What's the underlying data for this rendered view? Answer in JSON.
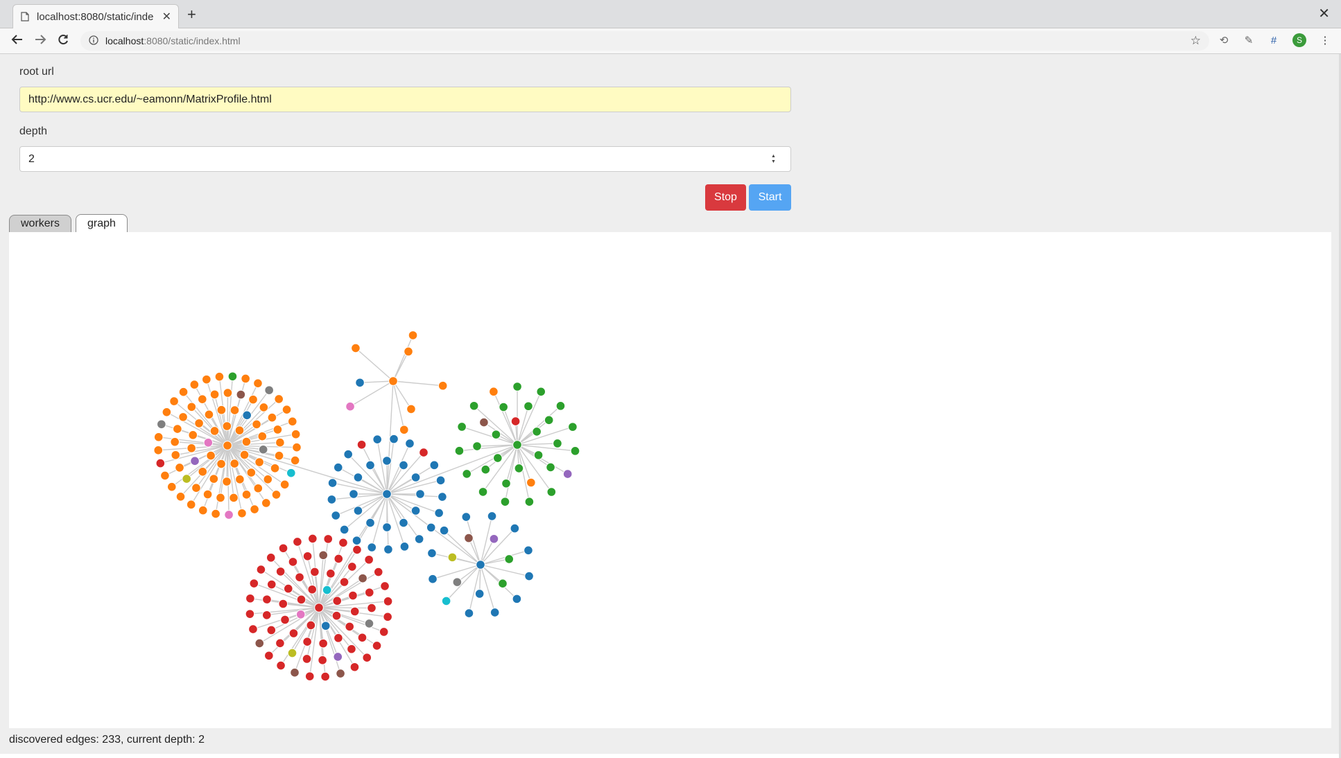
{
  "browser": {
    "tab_title": "localhost:8080/static/inde",
    "address_host": "localhost",
    "address_path": ":8080/static/index.html",
    "avatar_letter": "S"
  },
  "form": {
    "root_label": "root url",
    "root_value": "http://www.cs.ucr.edu/~eamonn/MatrixProfile.html",
    "depth_label": "depth",
    "depth_value": "2",
    "stop_label": "Stop",
    "start_label": "Start"
  },
  "tabs": [
    {
      "label": "workers",
      "active": false
    },
    {
      "label": "graph",
      "active": true
    }
  ],
  "status": "discovered edges: 233, current depth: 2",
  "colors": {
    "stop": "#d9393e",
    "start": "#55a5f3",
    "url_field": "#fffbc2",
    "edge": "#cccccc",
    "node_palette": {
      "orange": "#ff7f0e",
      "blue": "#1f77b4",
      "green": "#2ca02c",
      "red": "#d62728",
      "purple": "#9467bd",
      "brown": "#8c564b",
      "pink": "#e377c2",
      "gray": "#7f7f7f",
      "olive": "#bcbd22",
      "cyan": "#17becf"
    }
  },
  "graph": {
    "hubs": [
      {
        "id": "center",
        "color": "blue",
        "leaves": [
          "blue",
          "blue",
          "blue",
          "blue",
          "blue",
          "blue",
          "blue",
          "blue",
          "blue",
          "blue",
          "blue",
          "blue",
          "blue",
          "blue",
          "blue",
          "blue",
          "blue",
          "blue",
          "blue",
          "blue",
          "blue",
          "blue",
          "blue",
          "blue",
          "blue",
          "blue",
          "blue",
          "blue",
          "blue",
          "blue",
          "blue",
          "red",
          "red"
        ]
      },
      {
        "id": "orange-cluster",
        "color": "orange",
        "leaves": [
          "orange",
          "orange",
          "orange",
          "orange",
          "orange",
          "orange",
          "orange",
          "orange",
          "orange",
          "orange",
          "orange",
          "orange",
          "orange",
          "orange",
          "orange",
          "orange",
          "orange",
          "orange",
          "orange",
          "orange",
          "orange",
          "orange",
          "orange",
          "orange",
          "orange",
          "orange",
          "orange",
          "orange",
          "orange",
          "orange",
          "orange",
          "orange",
          "orange",
          "orange",
          "orange",
          "orange",
          "orange",
          "orange",
          "orange",
          "orange",
          "orange",
          "orange",
          "orange",
          "orange",
          "orange",
          "orange",
          "orange",
          "orange",
          "orange",
          "orange",
          "orange",
          "orange",
          "orange",
          "orange",
          "orange",
          "orange",
          "orange",
          "orange",
          "orange",
          "orange",
          "orange",
          "orange",
          "orange",
          "orange",
          "orange",
          "orange",
          "orange",
          "orange",
          "orange",
          "orange",
          "orange",
          "orange",
          "gray",
          "gray",
          "gray",
          "purple",
          "pink",
          "pink",
          "brown",
          "cyan",
          "olive",
          "green",
          "blue",
          "red"
        ]
      },
      {
        "id": "top-cluster",
        "color": "orange",
        "leaves": [
          "orange",
          "orange",
          "orange",
          "orange",
          "orange",
          "orange",
          "pink",
          "blue"
        ]
      },
      {
        "id": "green-cluster",
        "color": "green",
        "leaves": [
          "green",
          "green",
          "green",
          "green",
          "green",
          "green",
          "green",
          "green",
          "green",
          "green",
          "green",
          "green",
          "green",
          "green",
          "green",
          "green",
          "green",
          "green",
          "green",
          "green",
          "green",
          "green",
          "green",
          "green",
          "green",
          "green",
          "red",
          "brown",
          "orange",
          "orange",
          "purple"
        ]
      },
      {
        "id": "red-cluster",
        "color": "red",
        "leaves": [
          "red",
          "red",
          "red",
          "red",
          "red",
          "red",
          "red",
          "red",
          "red",
          "red",
          "red",
          "red",
          "red",
          "red",
          "red",
          "red",
          "red",
          "red",
          "red",
          "red",
          "red",
          "red",
          "red",
          "red",
          "red",
          "red",
          "red",
          "red",
          "red",
          "red",
          "red",
          "red",
          "red",
          "red",
          "red",
          "red",
          "red",
          "red",
          "red",
          "red",
          "red",
          "red",
          "red",
          "red",
          "red",
          "red",
          "red",
          "red",
          "red",
          "red",
          "red",
          "red",
          "red",
          "red",
          "red",
          "red",
          "red",
          "red",
          "red",
          "red",
          "brown",
          "brown",
          "brown",
          "brown",
          "brown",
          "gray",
          "pink",
          "purple",
          "cyan",
          "olive",
          "blue"
        ]
      },
      {
        "id": "blue-cluster",
        "color": "blue",
        "leaves": [
          "blue",
          "blue",
          "blue",
          "blue",
          "blue",
          "blue",
          "blue",
          "blue",
          "blue",
          "blue",
          "blue",
          "blue",
          "green",
          "green",
          "purple",
          "brown",
          "olive",
          "gray",
          "cyan"
        ]
      }
    ]
  }
}
